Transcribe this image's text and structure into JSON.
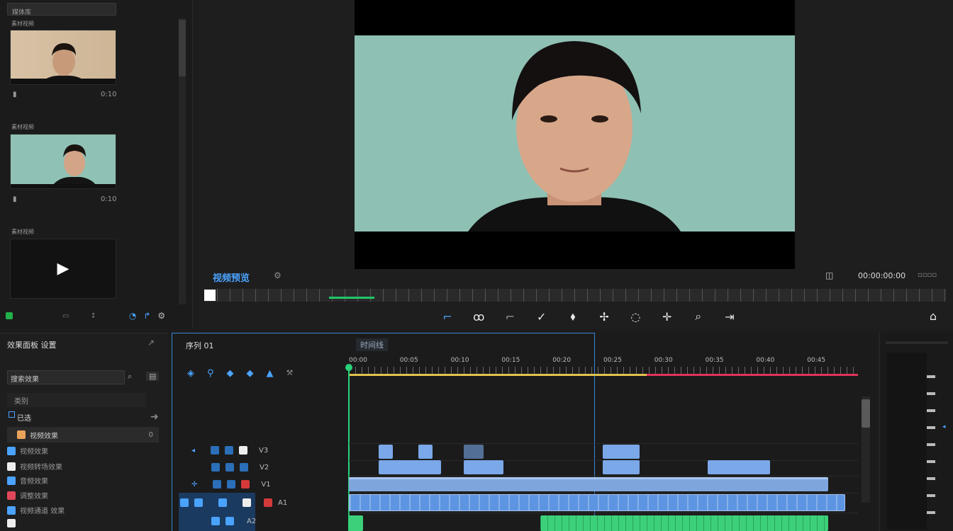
{
  "media": {
    "search_label": "媒体库",
    "items": [
      {
        "title": "素材视频",
        "meta_left": "▮",
        "meta_right": "0:10"
      },
      {
        "title": "素材视频",
        "meta_left": "▮",
        "meta_right": "0:10"
      },
      {
        "title": "素材视频",
        "meta_left": "",
        "meta_right": ""
      }
    ]
  },
  "viewer": {
    "title": "视频预览",
    "timecode": "00:00:00:00"
  },
  "toolbar": {
    "icons": [
      "crop-icon",
      "split-icon",
      "trim-icon",
      "check-icon",
      "marker-icon",
      "key-icon",
      "lasso-icon",
      "pin-icon",
      "zoom-icon",
      "export-icon"
    ],
    "home_icon": "home-icon"
  },
  "effects": {
    "title": "效果面板 设置",
    "search_placeholder": "搜索效果",
    "category": "类别",
    "selected": "已选",
    "items": [
      {
        "label": "视频效果",
        "value": "0"
      },
      {
        "label": "视频效果",
        "value": ""
      },
      {
        "label": "视频转场效果",
        "value": ""
      },
      {
        "label": "音频效果",
        "value": ""
      },
      {
        "label": "调整效果",
        "value": ""
      },
      {
        "label": "视频通道 效果",
        "value": ""
      }
    ]
  },
  "timeline": {
    "sequence_name": "序列 01",
    "tab_label": "时间线",
    "ruler": [
      "00:00",
      "00:05",
      "00:10",
      "00:15",
      "00:20",
      "00:25",
      "00:30",
      "00:35",
      "00:40",
      "00:45"
    ],
    "tracks": [
      {
        "name": "V3"
      },
      {
        "name": "V2"
      },
      {
        "name": "V1"
      },
      {
        "name": "A1"
      },
      {
        "name": "A2"
      }
    ]
  }
}
